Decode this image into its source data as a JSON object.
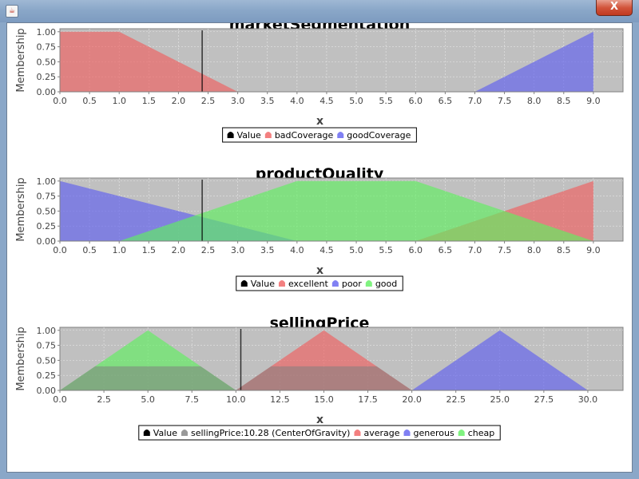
{
  "window": {
    "close_label": "X",
    "icon_name": "java-icon"
  },
  "chart_data": [
    {
      "type": "area",
      "title": "marketSegmentation",
      "xlabel": "x",
      "ylabel": "Membership",
      "xlim": [
        0,
        9.5
      ],
      "ylim": [
        0,
        1.05
      ],
      "x_ticks": [
        "0.0",
        "0.5",
        "1.0",
        "1.5",
        "2.0",
        "2.5",
        "3.0",
        "3.5",
        "4.0",
        "4.5",
        "5.0",
        "5.5",
        "6.0",
        "6.5",
        "7.0",
        "7.5",
        "8.0",
        "8.5",
        "9.0"
      ],
      "y_ticks": [
        "0.00",
        "0.25",
        "0.50",
        "0.75",
        "1.00"
      ],
      "value_x": 2.4,
      "series": [
        {
          "name": "badCoverage",
          "color": "#f06060",
          "points": [
            [
              0,
              1
            ],
            [
              1,
              1
            ],
            [
              3,
              0
            ]
          ]
        },
        {
          "name": "goodCoverage",
          "color": "#6060f0",
          "points": [
            [
              7,
              0
            ],
            [
              9,
              1
            ]
          ]
        }
      ],
      "legend": [
        "Value",
        "badCoverage",
        "goodCoverage"
      ],
      "legend_colors": [
        "#000000",
        "#f06060",
        "#6060f0"
      ],
      "grid": true,
      "legend_position": "bottom"
    },
    {
      "type": "area",
      "title": "productQuality",
      "xlabel": "x",
      "ylabel": "Membership",
      "xlim": [
        0,
        9.5
      ],
      "ylim": [
        0,
        1.05
      ],
      "x_ticks": [
        "0.0",
        "0.5",
        "1.0",
        "1.5",
        "2.0",
        "2.5",
        "3.0",
        "3.5",
        "4.0",
        "4.5",
        "5.0",
        "5.5",
        "6.0",
        "6.5",
        "7.0",
        "7.5",
        "8.0",
        "8.5",
        "9.0"
      ],
      "y_ticks": [
        "0.00",
        "0.25",
        "0.50",
        "0.75",
        "1.00"
      ],
      "value_x": 2.4,
      "series": [
        {
          "name": "excellent",
          "color": "#f06060",
          "points": [
            [
              6,
              0
            ],
            [
              9,
              1
            ]
          ]
        },
        {
          "name": "poor",
          "color": "#6060f0",
          "points": [
            [
              0,
              1
            ],
            [
              4,
              0
            ]
          ]
        },
        {
          "name": "good",
          "color": "#60f060",
          "points": [
            [
              1,
              0
            ],
            [
              4,
              1
            ],
            [
              6,
              1
            ],
            [
              9,
              0
            ]
          ]
        }
      ],
      "legend": [
        "Value",
        "excellent",
        "poor",
        "good"
      ],
      "legend_colors": [
        "#000000",
        "#f06060",
        "#6060f0",
        "#60f060"
      ],
      "grid": true,
      "legend_position": "bottom"
    },
    {
      "type": "area",
      "title": "sellingPrice",
      "xlabel": "x",
      "ylabel": "Membership",
      "xlim": [
        0,
        32
      ],
      "ylim": [
        0,
        1.05
      ],
      "x_ticks": [
        "0.0",
        "2.5",
        "5.0",
        "7.5",
        "10.0",
        "12.5",
        "15.0",
        "17.5",
        "20.0",
        "22.5",
        "25.0",
        "27.5",
        "30.0"
      ],
      "y_ticks": [
        "0.00",
        "0.25",
        "0.50",
        "0.75",
        "1.00"
      ],
      "value_x": 10.28,
      "series": [
        {
          "name": "average",
          "color": "#f06060",
          "points": [
            [
              10,
              0
            ],
            [
              15,
              1
            ],
            [
              20,
              0
            ]
          ]
        },
        {
          "name": "generous",
          "color": "#6060f0",
          "points": [
            [
              20,
              0
            ],
            [
              25,
              1
            ],
            [
              30,
              0
            ]
          ]
        },
        {
          "name": "cheap",
          "color": "#60f060",
          "points": [
            [
              0,
              0
            ],
            [
              5,
              1
            ],
            [
              10,
              0
            ]
          ]
        }
      ],
      "aggregate": {
        "name": "sellingPrice:10.28 (CenterOfGravity)",
        "color": "#808080",
        "points": [
          [
            0,
            0
          ],
          [
            2,
            0.4
          ],
          [
            8,
            0.4
          ],
          [
            10,
            0
          ],
          [
            12,
            0.4
          ],
          [
            18,
            0.4
          ],
          [
            20,
            0
          ]
        ]
      },
      "legend": [
        "Value",
        "sellingPrice:10.28 (CenterOfGravity)",
        "average",
        "generous",
        "cheap"
      ],
      "legend_colors": [
        "#000000",
        "#808080",
        "#f06060",
        "#6060f0",
        "#60f060"
      ],
      "grid": true,
      "legend_position": "bottom"
    }
  ]
}
